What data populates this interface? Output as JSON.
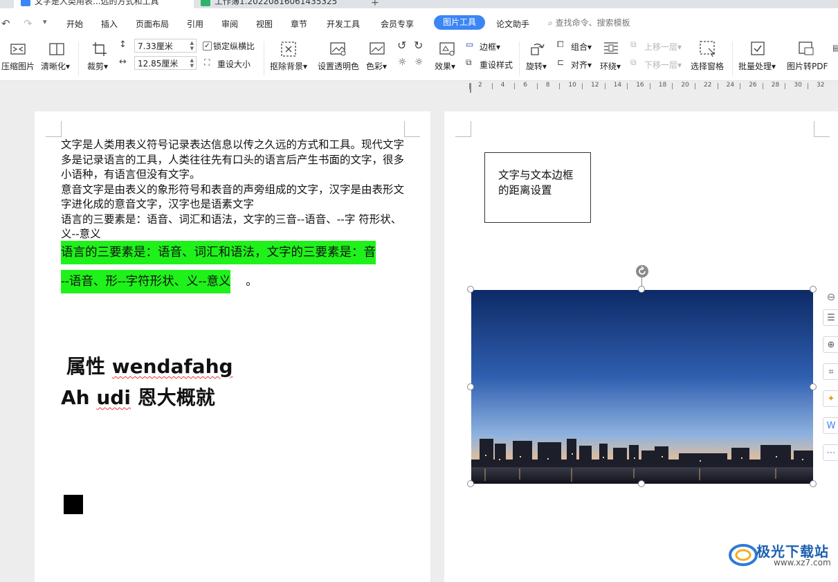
{
  "tabs": [
    {
      "title": "文字是人类用表...远的方式和工具",
      "modified": true
    },
    {
      "title": "工作簿1.20220816061435325"
    }
  ],
  "quick_access": {
    "undo": "↶",
    "redo": "↷",
    "more": "▾"
  },
  "menu": [
    "开始",
    "插入",
    "页面布局",
    "引用",
    "审阅",
    "视图",
    "章节",
    "开发工具",
    "会员专享",
    "图片工具",
    "论文助手"
  ],
  "active_menu": "图片工具",
  "search_placeholder": "查找命令、搜索模板",
  "ribbon": {
    "compress": "压缩图片",
    "sharpen": "清晰化",
    "crop": "裁剪",
    "width": "7.33厘米",
    "height": "12.85厘米",
    "lock_ratio": "锁定纵横比",
    "reset_size": "重设大小",
    "remove_bg": "抠除背景",
    "set_transparent": "设置透明色",
    "color": "色彩",
    "effects": "效果",
    "border": "边框",
    "reset_style": "重设样式",
    "rotate": "旋转",
    "group": "组合",
    "align": "对齐",
    "wrap": "环绕",
    "bring_forward": "上移一层",
    "send_backward": "下移一层",
    "selection_pane": "选择窗格",
    "batch": "批量处理",
    "to_pdf": "图片转PDF"
  },
  "ruler_labels": [
    "2",
    "4",
    "6",
    "8",
    "10",
    "12",
    "14",
    "16",
    "18",
    "20",
    "22",
    "24",
    "26",
    "28",
    "30",
    "32"
  ],
  "page1": {
    "paragraphs": [
      "文字是人类用表义符号记录表达信息以传之久远的方式和工具。现代文字多是记录语言的工具，人类往往先有口头的语言后产生书面的文字，很多小语种，有语言但没有文字。",
      "意音文字是由表义的象形符号和表音的声旁组成的文字，汉字是由表形文字进化成的意音文字，汉字也是语素文字",
      "语言的三要素是：语音、词汇和语法，文字的三音--语音、--字  符形状、义--意义"
    ],
    "highlight_line1": "语言的三要素是：语音、词汇和语法，文字的三要素是：音",
    "highlight_line2": "--语音、形--字符形状、义--意义",
    "highlight_end": "。",
    "big_line1_cn": "属性",
    "big_line1_en": "wendafahg",
    "big_line2_en1": "Ah",
    "big_line2_en2": "udi",
    "big_line2_cn": "恩大概就"
  },
  "page2": {
    "textbox": "文字与文本边框的距离设置"
  },
  "watermark": {
    "name": "极光下载站",
    "url": "www.xz7.com"
  },
  "colors": {
    "accent": "#3b86f5",
    "highlight": "#1ff21a"
  }
}
